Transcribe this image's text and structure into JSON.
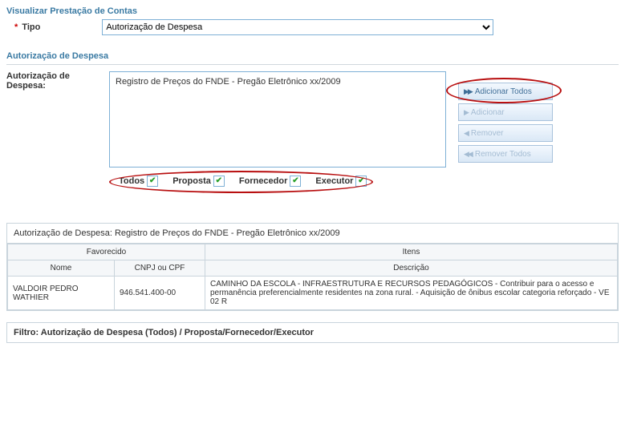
{
  "header": {
    "title": "Visualizar Prestação de Contas",
    "tipo_label": "Tipo",
    "tipo_value": "Autorização de Despesa"
  },
  "section": {
    "title": "Autorização de Despesa",
    "auth_label": "Autorização de Despesa:",
    "list_item": "Registro de Preços do FNDE - Pregão Eletrônico xx/2009",
    "buttons": {
      "adicionar_todos": "Adicionar Todos",
      "adicionar": "Adicionar",
      "remover": "Remover",
      "remover_todos": "Remover Todos"
    },
    "checks": {
      "todos": "Todos",
      "proposta": "Proposta",
      "fornecedor": "Fornecedor",
      "executor": "Executor"
    }
  },
  "panel": {
    "title": "Autorização de Despesa: Registro de Preços do FNDE - Pregão Eletrônico xx/2009",
    "headers": {
      "favorecido": "Favorecido",
      "itens": "Itens",
      "nome": "Nome",
      "cnpj": "CNPJ ou CPF",
      "descricao": "Descrição"
    },
    "row": {
      "nome": "VALDOIR PEDRO WATHIER",
      "cnpj": "946.541.400-00",
      "descricao": "CAMINHO DA ESCOLA - INFRAESTRUTURA E RECURSOS PEDAGÓGICOS - Contribuir para o acesso e permanência preferencialmente residentes na zona rural. - Aquisição de ônibus escolar categoria reforçado - VE 02 R"
    }
  },
  "filter": {
    "text": "Filtro: Autorização de Despesa (Todos) / Proposta/Fornecedor/Executor"
  }
}
